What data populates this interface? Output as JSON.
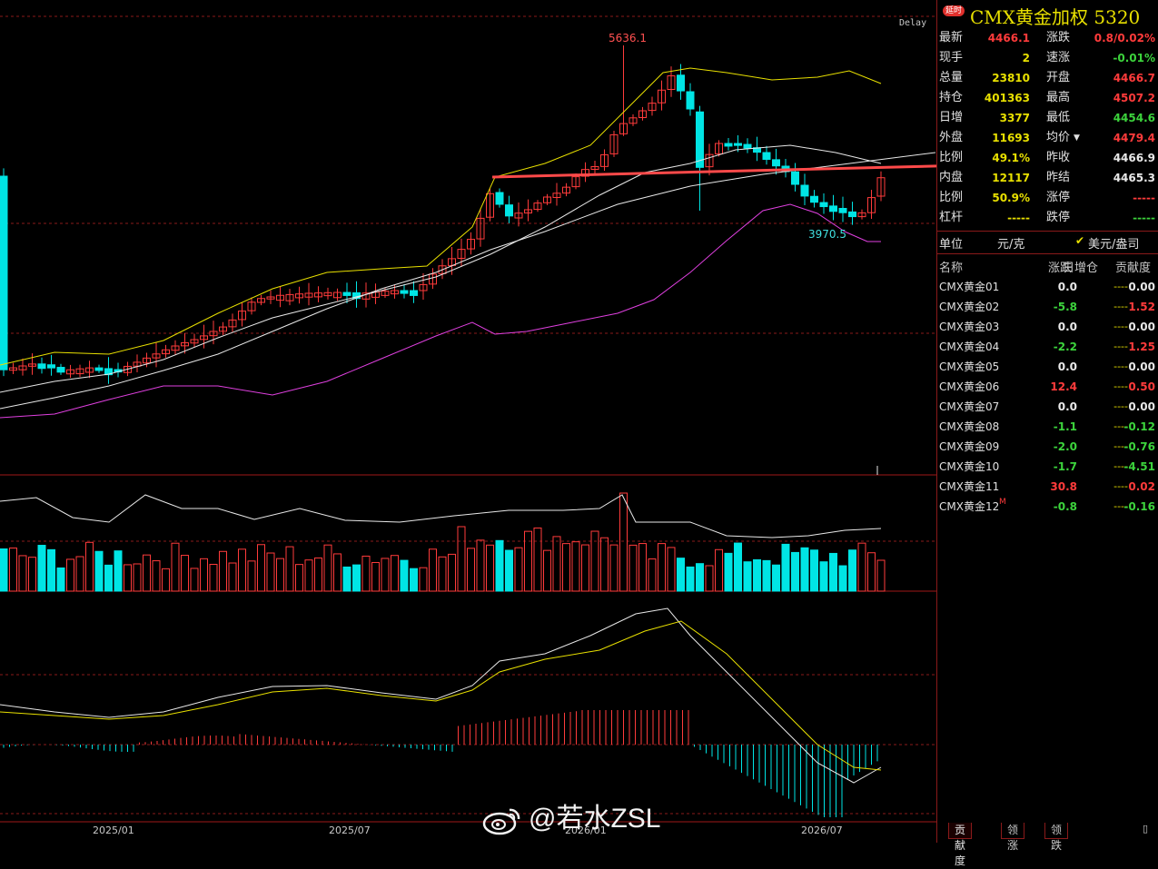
{
  "chart": {
    "delay_label": "Delay",
    "high_label": "5636.1",
    "low_label": "3970.5",
    "x_axis": [
      "2025/01",
      "2025/07",
      "2026/01",
      "2026/07"
    ]
  },
  "watermark": "@若水ZSL",
  "side": {
    "tag": "延时",
    "title": "CMX黄金加权 5320",
    "quote": [
      {
        "l": "最新",
        "v": "4466.1",
        "c": "red",
        "l2": "涨跌",
        "v2": "0.8/0.02%",
        "c2": "red"
      },
      {
        "l": "现手",
        "v": "2",
        "c": "yellow",
        "l2": "速涨",
        "v2": "-0.01%",
        "c2": "green"
      },
      {
        "l": "总量",
        "v": "23810",
        "c": "yellow",
        "l2": "开盘",
        "v2": "4466.7",
        "c2": "red"
      },
      {
        "l": "持仓",
        "v": "401363",
        "c": "yellow",
        "l2": "最高",
        "v2": "4507.2",
        "c2": "red"
      },
      {
        "l": "日增",
        "v": "3377",
        "c": "yellow",
        "l2": "最低",
        "v2": "4454.6",
        "c2": "green"
      },
      {
        "l": "外盘",
        "v": "11693",
        "c": "yellow",
        "l2": "均价",
        "v2": "4479.4",
        "c2": "red"
      },
      {
        "l": "比例",
        "v": "49.1%",
        "c": "yellow",
        "l2": "昨收",
        "v2": "4466.9",
        "c2": "white"
      },
      {
        "l": "内盘",
        "v": "12117",
        "c": "yellow",
        "l2": "昨结",
        "v2": "4465.3",
        "c2": "white"
      },
      {
        "l": "比例",
        "v": "50.9%",
        "c": "yellow",
        "l2": "涨停",
        "v2": "-----",
        "c2": "red"
      },
      {
        "l": "杠杆",
        "v": "-----",
        "c": "yellow",
        "l2": "跌停",
        "v2": "-----",
        "c2": "green"
      }
    ],
    "unit_label": "单位",
    "unit_value": "元/克",
    "unit_option": "美元/盎司",
    "list_headers": [
      "名称",
      "涨跌",
      "日增仓",
      "贡献度"
    ],
    "contracts": [
      {
        "name": "CMX黄金01",
        "chg": "0.0",
        "cc": "white",
        "inc": "----",
        "con": "0.00",
        "kc": "white"
      },
      {
        "name": "CMX黄金02",
        "chg": "-5.8",
        "cc": "green",
        "inc": "----",
        "con": "1.52",
        "kc": "red"
      },
      {
        "name": "CMX黄金03",
        "chg": "0.0",
        "cc": "white",
        "inc": "----",
        "con": "0.00",
        "kc": "white"
      },
      {
        "name": "CMX黄金04",
        "chg": "-2.2",
        "cc": "green",
        "inc": "----",
        "con": "1.25",
        "kc": "red"
      },
      {
        "name": "CMX黄金05",
        "chg": "0.0",
        "cc": "white",
        "inc": "----",
        "con": "0.00",
        "kc": "white"
      },
      {
        "name": "CMX黄金06",
        "chg": "12.4",
        "cc": "red",
        "inc": "----",
        "con": "0.50",
        "kc": "red"
      },
      {
        "name": "CMX黄金07",
        "chg": "0.0",
        "cc": "white",
        "inc": "----",
        "con": "0.00",
        "kc": "white"
      },
      {
        "name": "CMX黄金08",
        "chg": "-1.1",
        "cc": "green",
        "inc": "----",
        "con": "-0.12",
        "kc": "green"
      },
      {
        "name": "CMX黄金09",
        "chg": "-2.0",
        "cc": "green",
        "inc": "----",
        "con": "-0.76",
        "kc": "green"
      },
      {
        "name": "CMX黄金10",
        "chg": "-1.7",
        "cc": "green",
        "inc": "----",
        "con": "-4.51",
        "kc": "green"
      },
      {
        "name": "CMX黄金11",
        "chg": "30.8",
        "cc": "red",
        "inc": "----",
        "con": "0.02",
        "kc": "red"
      },
      {
        "name": "CMX黄金12",
        "chg": "-0.8",
        "cc": "green",
        "inc": "----",
        "con": "-0.16",
        "kc": "green",
        "mark": "M"
      }
    ],
    "tabs": [
      "贡献度",
      "领涨",
      "领跌"
    ],
    "colors": {
      "up": "#ff3b3b",
      "down": "#00e5e5",
      "ma1": "#e8e000",
      "ma2": "#e8e8e8",
      "ma3": "#e040e0"
    }
  }
}
